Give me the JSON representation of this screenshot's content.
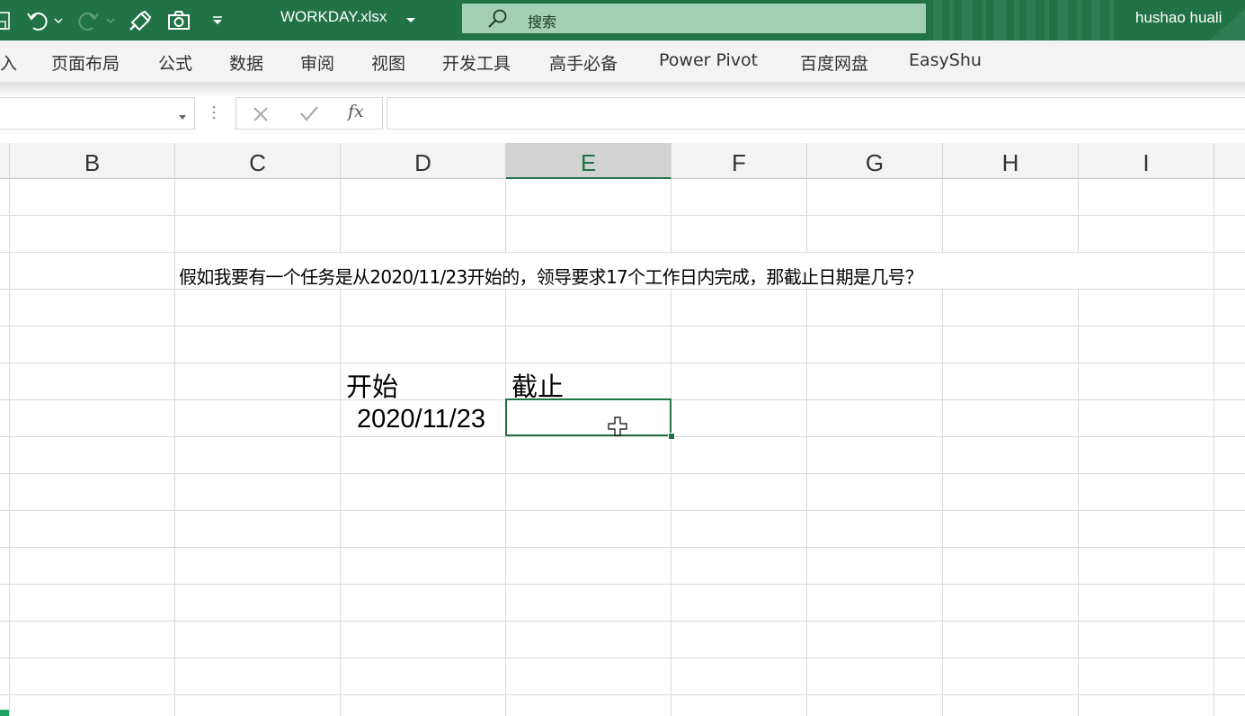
{
  "titlebar": {
    "filename": "WORKDAY.xlsx",
    "search_placeholder": "搜索",
    "user": "hushao huali",
    "colors": {
      "background": "#217346",
      "search_bg": "#a3cfb4"
    },
    "icons": [
      "save-icon",
      "undo-icon",
      "redo-icon",
      "format-painter-icon",
      "camera-icon",
      "customize-qat-icon",
      "search-icon"
    ]
  },
  "ribbon": {
    "tabs": [
      "入",
      "页面布局",
      "公式",
      "数据",
      "审阅",
      "视图",
      "开发工具",
      "高手必备",
      "Power Pivot",
      "百度网盘",
      "EasyShu"
    ]
  },
  "formula_bar": {
    "namebox_value": "",
    "fx_label": "fx",
    "formula_value": ""
  },
  "sheet": {
    "columns": [
      "B",
      "C",
      "D",
      "E",
      "F",
      "G",
      "H",
      "I"
    ],
    "selected_column": "E",
    "cells": {
      "question": "假如我要有一个任务是从2020/11/23开始的，领导要求17个工作日内完成，那截止日期是几号？",
      "label_start": "开始",
      "label_end": "截止",
      "start_date": "2020/11/23",
      "end_value": ""
    },
    "accent_color": "#217346"
  }
}
